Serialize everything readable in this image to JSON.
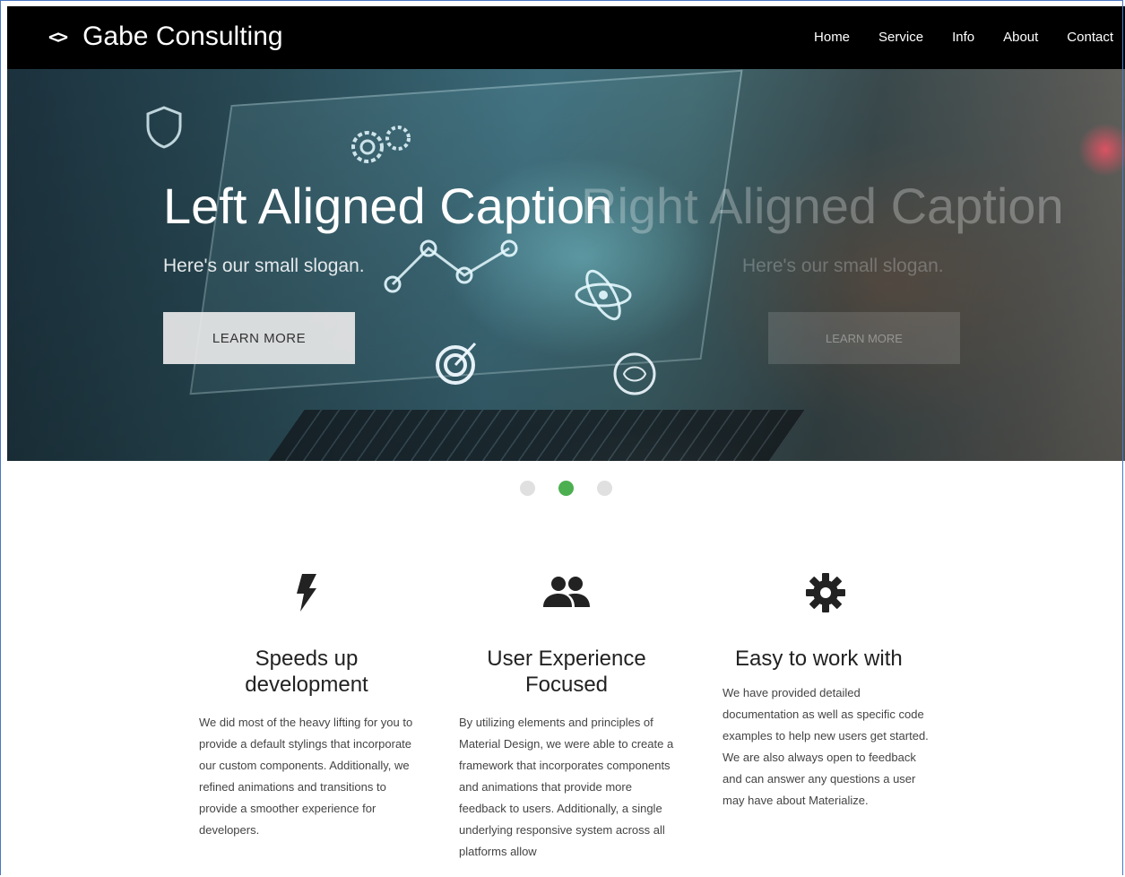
{
  "navbar": {
    "brand_icon": "<>",
    "brand": "Gabe Consulting",
    "links": [
      "Home",
      "Service",
      "Info",
      "About",
      "Contact"
    ]
  },
  "hero": {
    "caption_title": "Left Aligned Caption",
    "caption_slogan": "Here's our small slogan.",
    "button": "LEARN MORE",
    "ghost_title": "Right Aligned Caption",
    "ghost_slogan": "Here's our small slogan.",
    "ghost_button": "LEARN MORE",
    "active_slide": 2,
    "slide_count": 3
  },
  "features": [
    {
      "icon": "flash-icon",
      "title_line1": "Speeds up",
      "title_line2": "development",
      "text": "We did most of the heavy lifting for you to provide a default stylings that incorporate our custom components. Additionally, we refined animations and transitions to provide a smoother experience for developers."
    },
    {
      "icon": "group-icon",
      "title_line1": "User Experience",
      "title_line2": "Focused",
      "text": "By utilizing elements and principles of Material Design, we were able to create a framework that incorporates components and animations that provide more feedback to users. Additionally, a single underlying responsive system across all platforms allow"
    },
    {
      "icon": "gear-icon",
      "title_line1": "Easy to work with",
      "title_line2": "",
      "text": "We have provided detailed documentation as well as specific code examples to help new users get started. We are also always open to feedback and can answer any questions a user may have about Materialize."
    }
  ],
  "colors": {
    "navbar_bg": "#000000",
    "indicator_active": "#4caf50",
    "indicator_inactive": "#e0e0e0"
  }
}
